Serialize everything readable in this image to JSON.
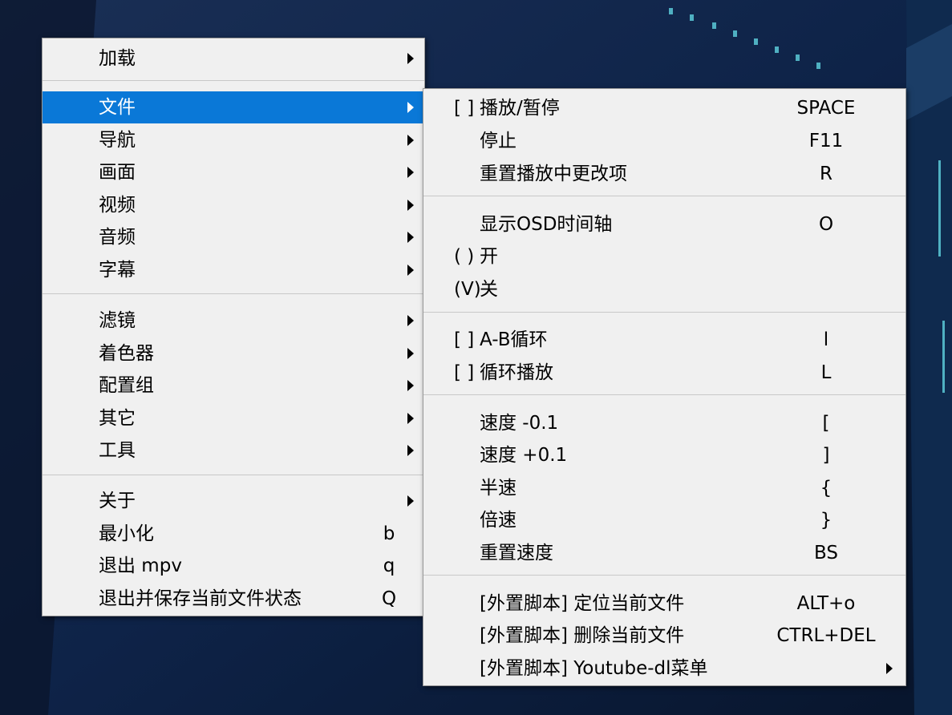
{
  "colors": {
    "selection": "#0a78d7",
    "menu_bg": "#f0f0f0",
    "separator": "#c8c8c8"
  },
  "main_menu": {
    "items": [
      {
        "label": "加载",
        "submenu": true
      },
      {
        "label": "文件",
        "submenu": true,
        "selected": true
      },
      {
        "label": "导航",
        "submenu": true
      },
      {
        "label": "画面",
        "submenu": true
      },
      {
        "label": "视频",
        "submenu": true
      },
      {
        "label": "音频",
        "submenu": true
      },
      {
        "label": "字幕",
        "submenu": true
      },
      {
        "label": "滤镜",
        "submenu": true
      },
      {
        "label": "着色器",
        "submenu": true
      },
      {
        "label": "配置组",
        "submenu": true
      },
      {
        "label": "其它",
        "submenu": true
      },
      {
        "label": "工具",
        "submenu": true
      },
      {
        "label": "关于",
        "submenu": true
      },
      {
        "label": "最小化",
        "shortcut": "b"
      },
      {
        "label": "退出 mpv",
        "shortcut": "q"
      },
      {
        "label": "退出并保存当前文件状态",
        "shortcut": "Q"
      }
    ]
  },
  "file_submenu": {
    "items": [
      {
        "check": "[ ]",
        "label": "播放/暂停",
        "shortcut": "SPACE"
      },
      {
        "label": "停止",
        "shortcut": "F11"
      },
      {
        "label": "重置播放中更改项",
        "shortcut": "R"
      },
      {
        "label": "显示OSD时间轴",
        "shortcut": "O"
      },
      {
        "check": "( )",
        "label": "开"
      },
      {
        "check": "(V)",
        "label": "关"
      },
      {
        "check": "[ ]",
        "label": "A-B循环",
        "shortcut": "l"
      },
      {
        "check": "[ ]",
        "label": "循环播放",
        "shortcut": "L"
      },
      {
        "label": "速度 -0.1",
        "shortcut": "["
      },
      {
        "label": "速度 +0.1",
        "shortcut": "]"
      },
      {
        "label": "半速",
        "shortcut": "{"
      },
      {
        "label": "倍速",
        "shortcut": "}"
      },
      {
        "label": "重置速度",
        "shortcut": "BS"
      },
      {
        "label": "[外置脚本] 定位当前文件",
        "shortcut": "ALT+o"
      },
      {
        "label": "[外置脚本] 删除当前文件",
        "shortcut": "CTRL+DEL"
      },
      {
        "label": "[外置脚本] Youtube-dl菜单",
        "submenu": true
      }
    ]
  }
}
